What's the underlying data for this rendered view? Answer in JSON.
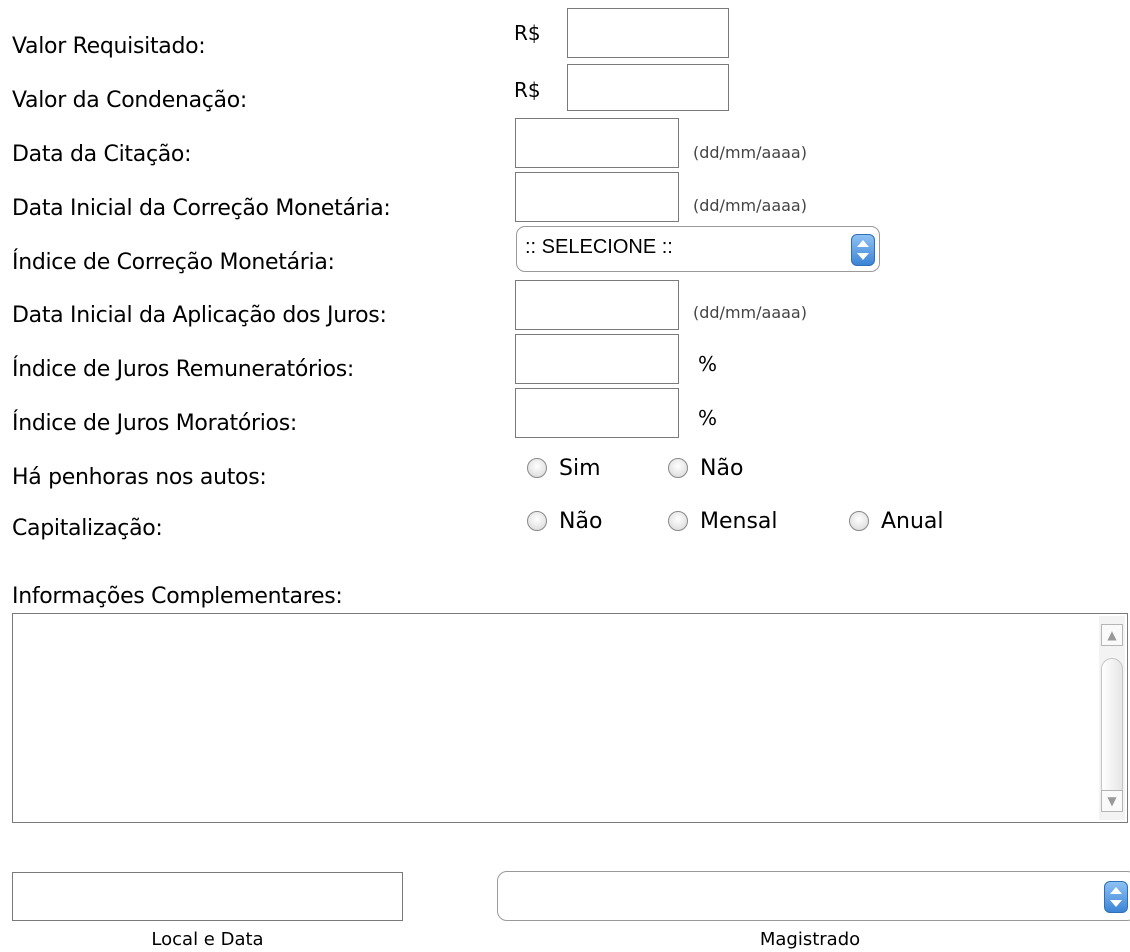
{
  "fields": {
    "valor_requisitado": {
      "label": "Valor Requisitado:",
      "prefix": "R$",
      "value": ""
    },
    "valor_condenacao": {
      "label": "Valor da Condenação:",
      "prefix": "R$",
      "value": ""
    },
    "data_citacao": {
      "label": "Data da Citação:",
      "value": "",
      "hint": "(dd/mm/aaaa)"
    },
    "data_inicial_correcao": {
      "label": "Data Inicial da Correção Monetária:",
      "value": "",
      "hint": "(dd/mm/aaaa)"
    },
    "indice_correcao": {
      "label": "Índice de Correção Monetária:",
      "selected": ":: SELECIONE ::"
    },
    "data_inicial_juros": {
      "label": "Data Inicial da Aplicação dos Juros:",
      "value": "",
      "hint": "(dd/mm/aaaa)"
    },
    "juros_remuneratorios": {
      "label": "Índice de Juros Remuneratórios:",
      "value": "",
      "unit": "%"
    },
    "juros_moratorios": {
      "label": "Índice de Juros Moratórios:",
      "value": "",
      "unit": "%"
    },
    "penhoras": {
      "label": "Há penhoras nos autos:",
      "options": [
        "Sim",
        "Não"
      ]
    },
    "capitalizacao": {
      "label": "Capitalização:",
      "options": [
        "Não",
        "Mensal",
        "Anual"
      ]
    }
  },
  "complementares": {
    "label": "Informações Complementares:",
    "value": ""
  },
  "footer": {
    "local_data": {
      "caption": "Local e Data",
      "value": ""
    },
    "magistrado": {
      "caption": "Magistrado",
      "selected": ""
    }
  },
  "colors": {
    "stepper": "#3d84d6",
    "border": "#7a7a7a"
  },
  "icons": [
    "radio-icon",
    "stepper-icon",
    "scroll-up-icon",
    "scroll-down-icon"
  ]
}
